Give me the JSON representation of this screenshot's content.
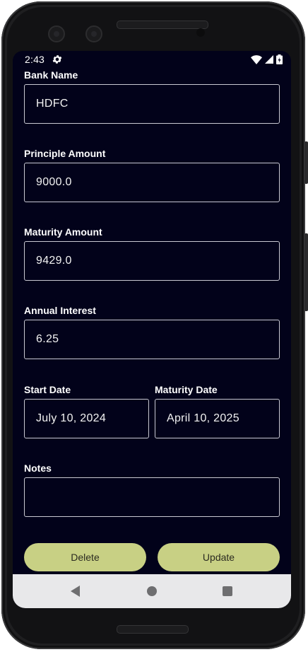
{
  "status_bar": {
    "time": "2:43",
    "icons": [
      "gear-icon",
      "wifi-icon",
      "signal-icon",
      "battery-icon"
    ]
  },
  "form": {
    "bank_name": {
      "label": "Bank Name",
      "value": "HDFC"
    },
    "principle_amount": {
      "label": "Principle Amount",
      "value": "9000.0"
    },
    "maturity_amount": {
      "label": "Maturity Amount",
      "value": "9429.0"
    },
    "annual_interest": {
      "label": "Annual Interest",
      "value": "6.25"
    },
    "start_date": {
      "label": "Start Date",
      "value": "July 10, 2024"
    },
    "maturity_date": {
      "label": "Maturity Date",
      "value": "April 10, 2025"
    },
    "notes": {
      "label": "Notes",
      "value": ""
    }
  },
  "actions": {
    "delete_label": "Delete",
    "update_label": "Update"
  },
  "colors": {
    "screen_background": "#02021a",
    "button_background": "#c8d084",
    "field_border": "#c9c9d2",
    "nav_bar_background": "#e8e8ea"
  },
  "nav_bar": {
    "icons": [
      "back-icon",
      "home-icon",
      "recents-icon"
    ]
  }
}
